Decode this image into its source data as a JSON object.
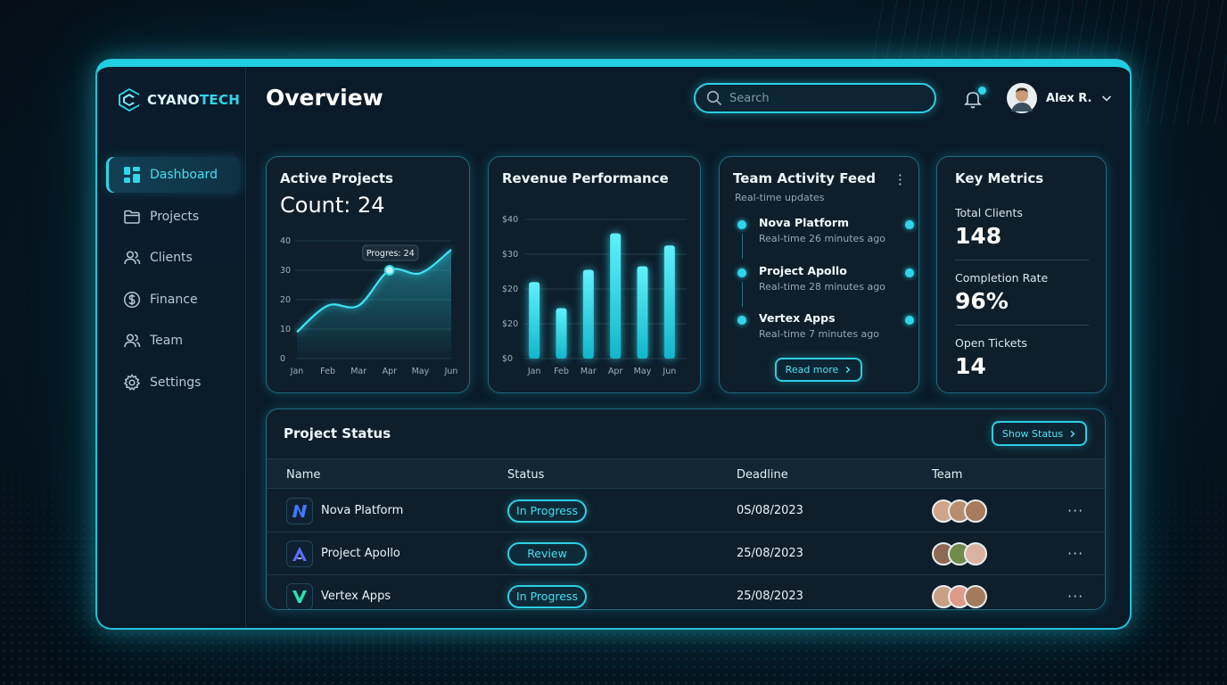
{
  "app": {
    "name_main": "CYANO",
    "name_accent": "TECH"
  },
  "page_title": "Overview",
  "search": {
    "placeholder": "Search"
  },
  "user": {
    "name": "Alex R."
  },
  "sidebar": {
    "items": [
      {
        "label": "Dashboard",
        "icon": "grid-icon",
        "active": true
      },
      {
        "label": "Projects",
        "icon": "folder-icon"
      },
      {
        "label": "Clients",
        "icon": "users-icon"
      },
      {
        "label": "Finance",
        "icon": "dollar-icon"
      },
      {
        "label": "Team",
        "icon": "team-icon"
      },
      {
        "label": "Settings",
        "icon": "gear-icon"
      }
    ]
  },
  "active_projects": {
    "title": "Active Projects",
    "count": "Count: 24",
    "tooltip": "Progres: 24"
  },
  "revenue": {
    "title": "Revenue Performance"
  },
  "team_feed": {
    "title": "Team Activity Feed",
    "subtitle": "Real-time updates",
    "items": [
      {
        "name": "Nova Platform",
        "time": "Real-time 26 minutes ago"
      },
      {
        "name": "Project Apollo",
        "time": "Real-time 28 minutes ago"
      },
      {
        "name": "Vertex Apps",
        "time": "Real-time 7 minutes ago"
      }
    ],
    "read_more": "Read more"
  },
  "key_metrics": {
    "title": "Key Metrics",
    "items": [
      {
        "label": "Total Clients",
        "value": "148"
      },
      {
        "label": "Completion Rate",
        "value": "96%"
      },
      {
        "label": "Open Tickets",
        "value": "14"
      }
    ]
  },
  "project_status": {
    "title": "Project Status",
    "show_status": "Show Status",
    "columns": [
      "Name",
      "Status",
      "Deadline",
      "Team"
    ],
    "rows": [
      {
        "name": "Nova Platform",
        "status": "In Progress",
        "deadline": "0S/08/2023",
        "logo_letter": "N",
        "logo_color": "#3b7bff"
      },
      {
        "name": "Project Apollo",
        "status": "Review",
        "deadline": "25/08/2023",
        "logo_letter": "A",
        "logo_color": "#5b6cff"
      },
      {
        "name": "Vertex Apps",
        "status": "In Progress",
        "deadline": "25/08/2023",
        "logo_letter": "V",
        "logo_color": "#2fe0b0"
      }
    ]
  },
  "colors": {
    "accent": "#2fd6ea",
    "panel": "#0e1e2b",
    "background": "#061825"
  },
  "chart_data": [
    {
      "type": "area",
      "title": "Active Projects",
      "categories": [
        "Jan",
        "Feb",
        "Mar",
        "Apr",
        "May",
        "Jun"
      ],
      "values": [
        9,
        18,
        18,
        30,
        29,
        37
      ],
      "ylim": [
        0,
        40
      ],
      "yticks": [
        0,
        10,
        20,
        30,
        40
      ],
      "highlight": {
        "category": "Apr",
        "value": 30,
        "label": "Progres: 24"
      },
      "grid": true
    },
    {
      "type": "bar",
      "title": "Revenue Performance",
      "categories": [
        "Jan",
        "Feb",
        "Mar",
        "Apr",
        "May",
        "Jun"
      ],
      "values": [
        22,
        14.5,
        25.5,
        36,
        26.5,
        32.5
      ],
      "ylim": [
        0,
        40
      ],
      "ytick_labels": [
        "$0",
        "$20",
        "$20",
        "$30",
        "$40"
      ],
      "grid": true
    }
  ]
}
